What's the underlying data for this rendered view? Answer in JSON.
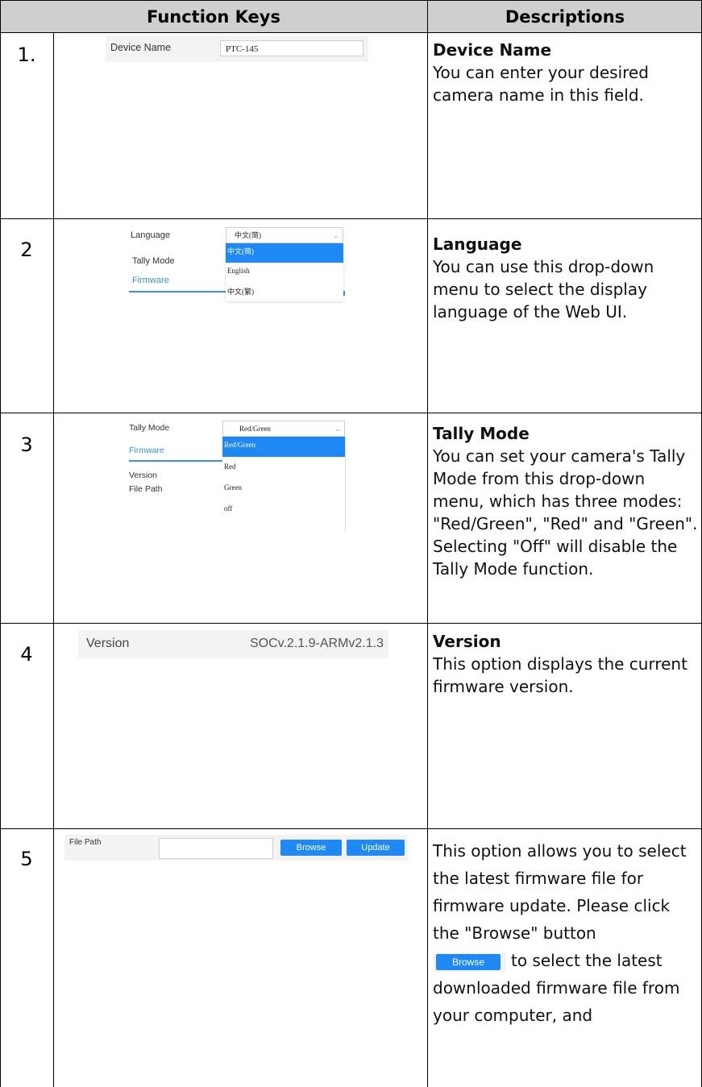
{
  "header": {
    "col1": "Function Keys",
    "col2": "Descriptions"
  },
  "rows": [
    {
      "num": "1.",
      "title": "Device Name",
      "desc": "You can enter your desired camera name in this field.",
      "ui": {
        "label": "Device Name",
        "value": "PTC-145"
      }
    },
    {
      "num": "2",
      "title": "Language",
      "desc": "You can use this drop-down menu to select the display language of the Web UI.",
      "ui": {
        "label_language": "Language",
        "label_tally": "Tally Mode",
        "label_firmware": "Firmware",
        "selected": "中文(简)",
        "options": [
          "中文(简)",
          "English",
          "中文(繁)"
        ]
      }
    },
    {
      "num": "3",
      "title": "Tally Mode",
      "desc": "You can set your camera's Tally Mode from this drop-down menu, which has three modes: \"Red/Green\", \"Red\" and \"Green\". Selecting \"Off\" will disable the Tally Mode function.",
      "ui": {
        "label_tally": "Tally Mode",
        "label_firmware": "Firmware",
        "label_version": "Version",
        "label_filepath": "File Path",
        "selected": "Red/Green",
        "options": [
          "Red/Green",
          "Red",
          "Green",
          "off"
        ]
      }
    },
    {
      "num": "4",
      "title": "Version",
      "desc": "This option displays the current firmware version.",
      "ui": {
        "label": "Version",
        "value": "SOCv.2.1.9-ARMv2.1.3"
      }
    },
    {
      "num": "5",
      "desc_part1": "This option allows you to select the latest firmware file for firmware update. Please click the \"Browse\" button",
      "desc_part2": "to select the latest downloaded firmware file from your computer, and",
      "inline_button": "Browse",
      "ui": {
        "label": "File Path",
        "browse": "Browse",
        "update": "Update"
      }
    }
  ],
  "colors": {
    "header_bg": "#d0cece",
    "accent": "#1e88f5",
    "link_blue": "#3b8fe0"
  }
}
